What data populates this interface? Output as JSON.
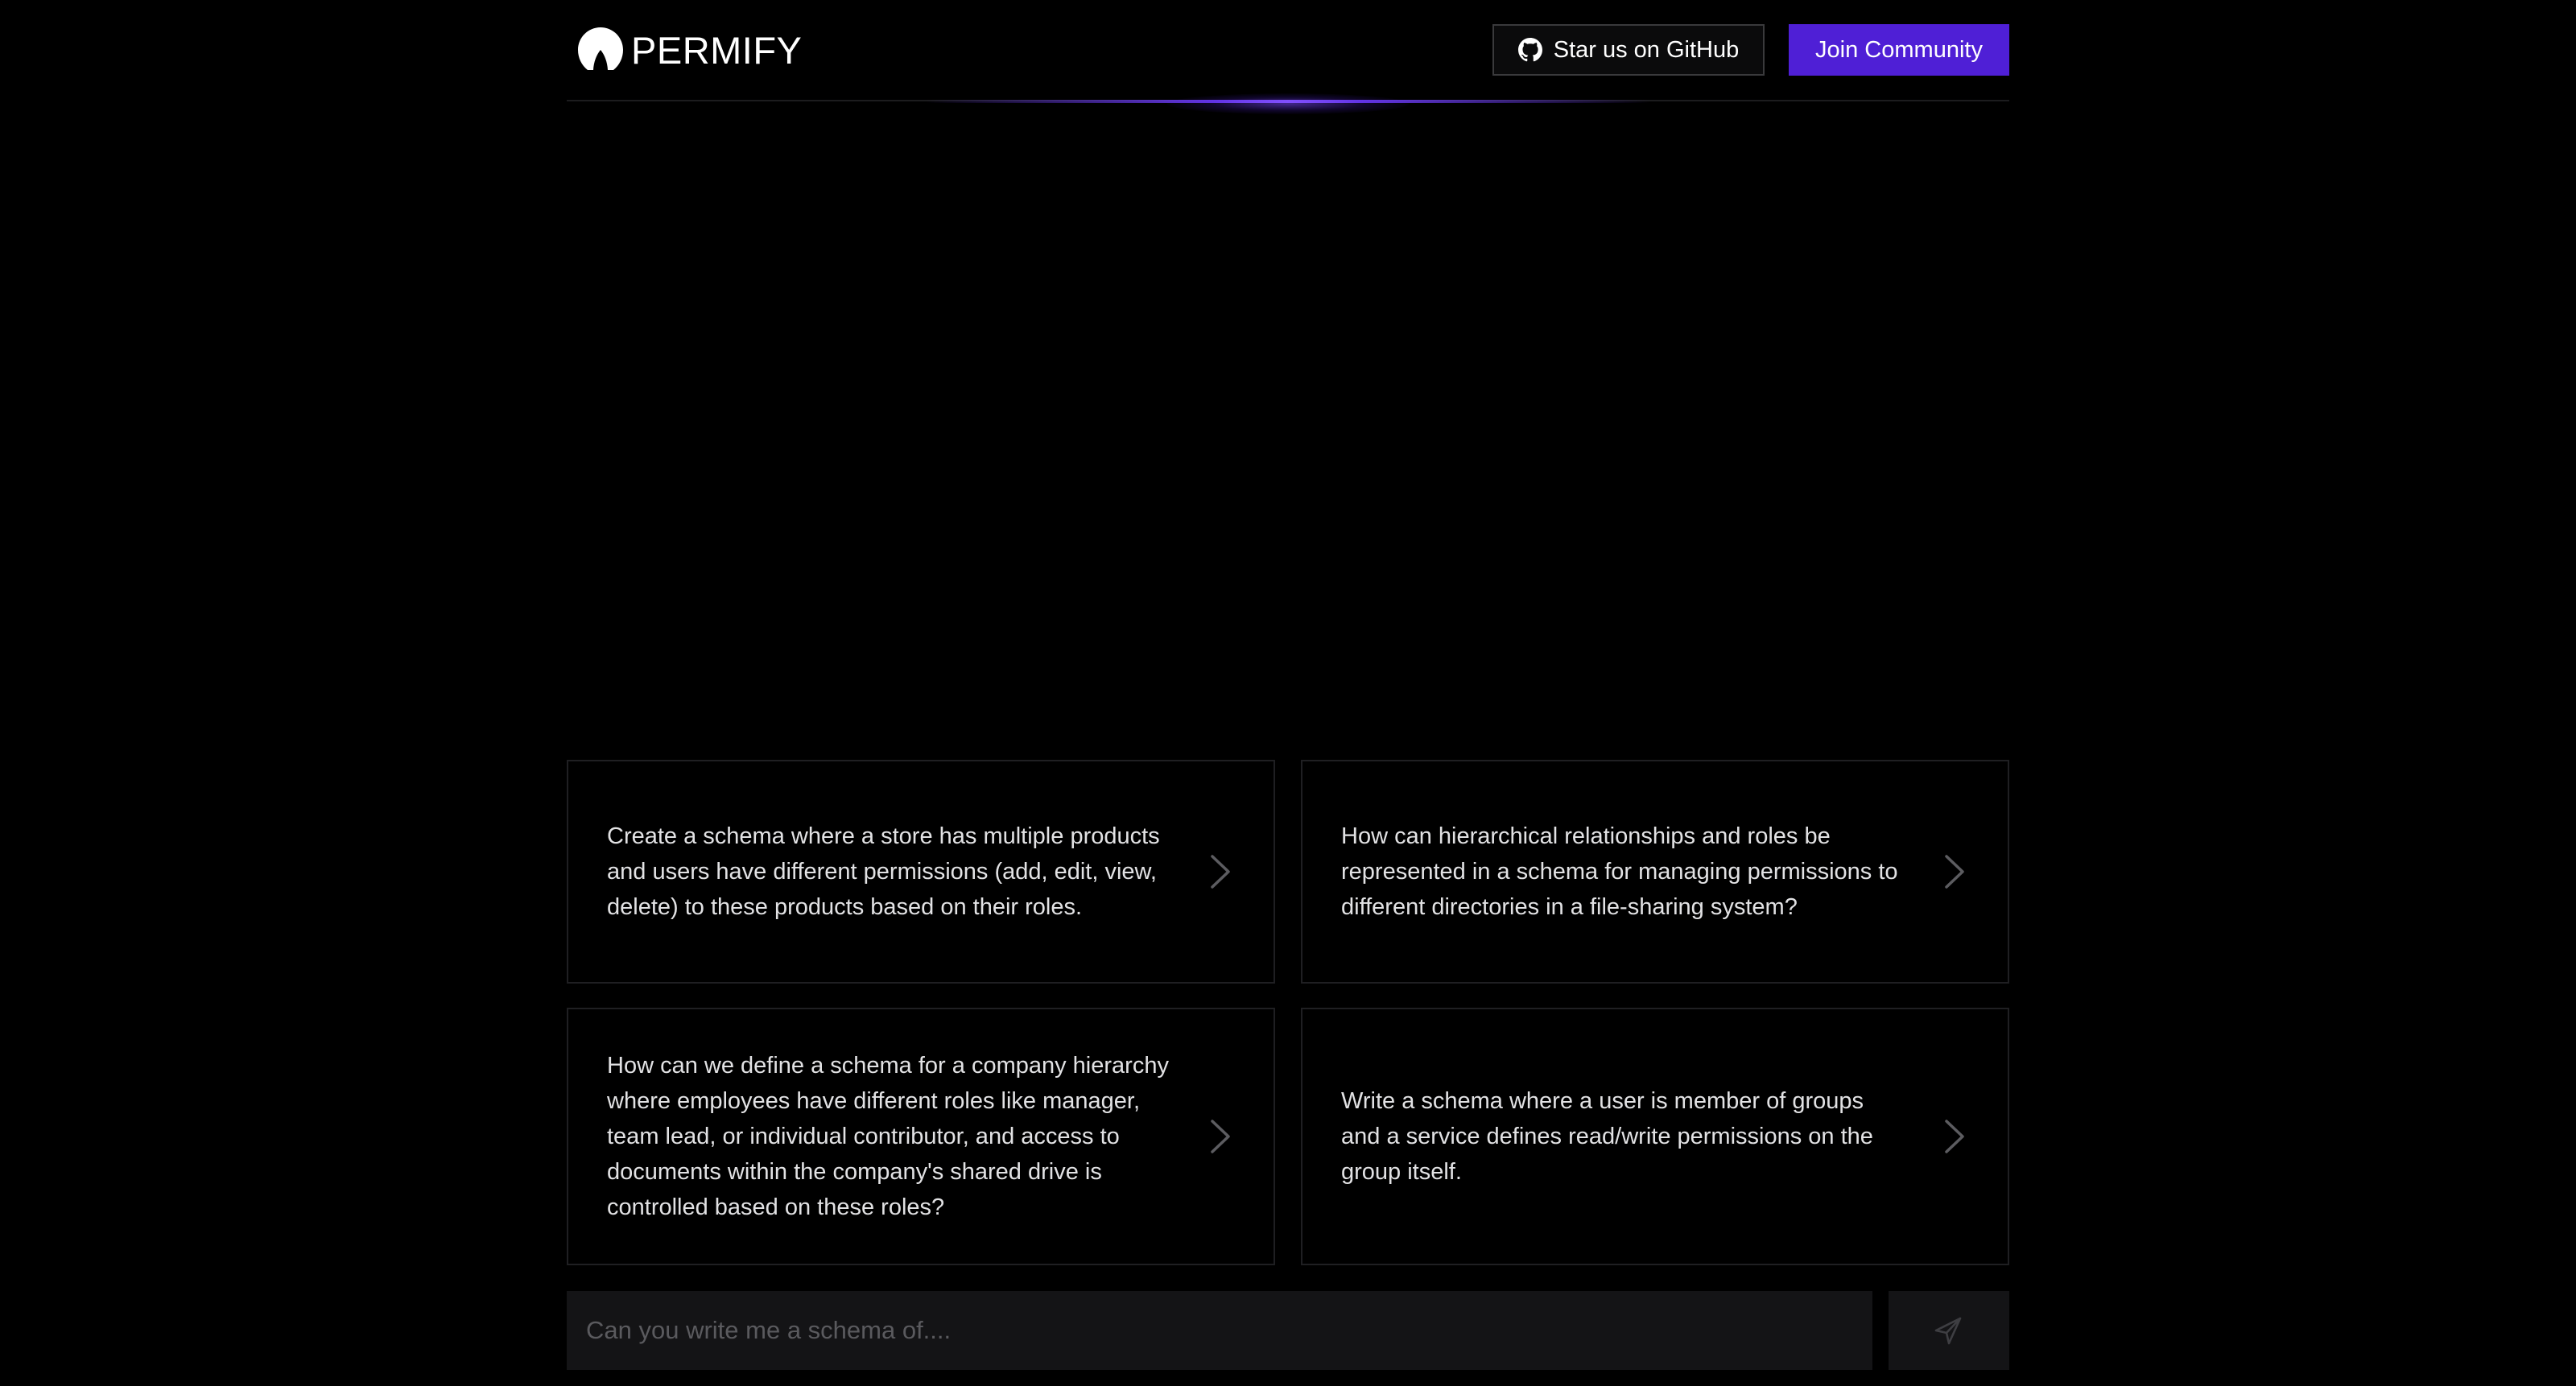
{
  "header": {
    "brand": "PERMIFY",
    "logo_icon": "permify-logo-icon",
    "github_button_label": "Star us on GitHub",
    "github_icon": "github-icon",
    "join_button_label": "Join Community"
  },
  "colors": {
    "background": "#000000",
    "accent": "#4f1fd6",
    "card_border": "#1f1f22",
    "input_background": "#141416"
  },
  "suggestions": [
    {
      "text": "Create a schema where a store has multiple products and users have different permissions (add, edit, view, delete) to these products based on their roles.",
      "icon": "chevron-right-icon"
    },
    {
      "text": "How can hierarchical relationships and roles be represented in a schema for managing permissions to different directories in a file-sharing system?",
      "icon": "chevron-right-icon"
    },
    {
      "text": "How can we define a schema for a company hierarchy where employees have different roles like manager, team lead, or individual contributor, and access to documents within the company's shared drive is controlled based on these roles?",
      "icon": "chevron-right-icon"
    },
    {
      "text": "Write a schema where a user is member of groups and a service defines read/write permissions on the group itself.",
      "icon": "chevron-right-icon"
    }
  ],
  "prompt": {
    "value": "",
    "placeholder": "Can you write me a schema of....",
    "send_icon": "send-icon"
  }
}
